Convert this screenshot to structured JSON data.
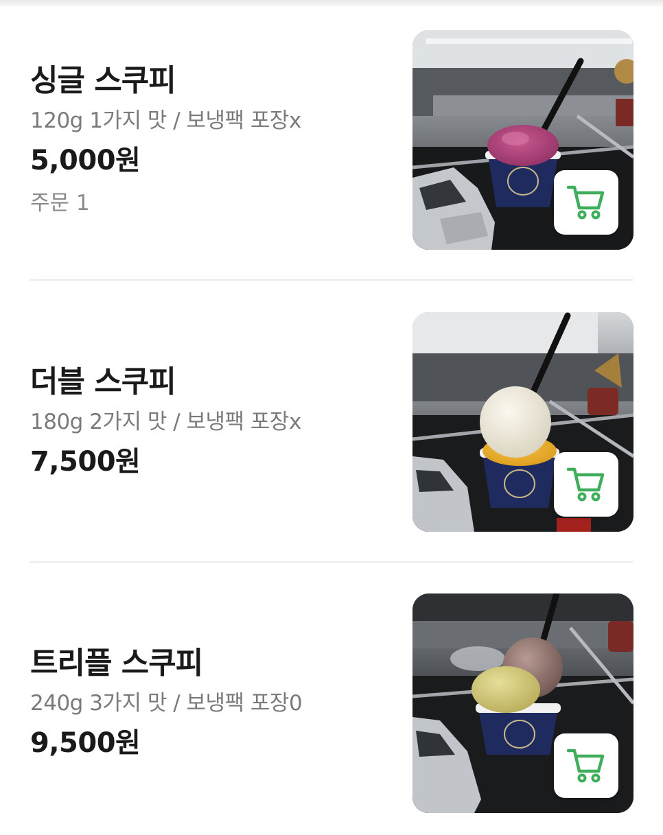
{
  "menu": {
    "items": [
      {
        "name": "싱글 스쿠피",
        "desc": "120g 1가지 맛 / 보냉팩 포장x",
        "price": "5,000원",
        "orders": "주문 1",
        "photo": "single-scoop-ice-cream-cup-photo",
        "cart_icon": "cart-icon"
      },
      {
        "name": "더블 스쿠피",
        "desc": "180g 2가지 맛 / 보냉팩 포장x",
        "price": "7,500원",
        "photo": "double-scoop-ice-cream-cup-photo",
        "cart_icon": "cart-icon"
      },
      {
        "name": "트리플 스쿠피",
        "desc": "240g 3가지 맛 / 보냉팩 포장0",
        "price": "9,500원",
        "photo": "triple-scoop-ice-cream-cup-photo",
        "cart_icon": "cart-icon"
      }
    ]
  },
  "colors": {
    "cart_icon": "#3fae5a",
    "price_text": "#1a1a1a",
    "secondary_text": "#7a7a7a"
  }
}
